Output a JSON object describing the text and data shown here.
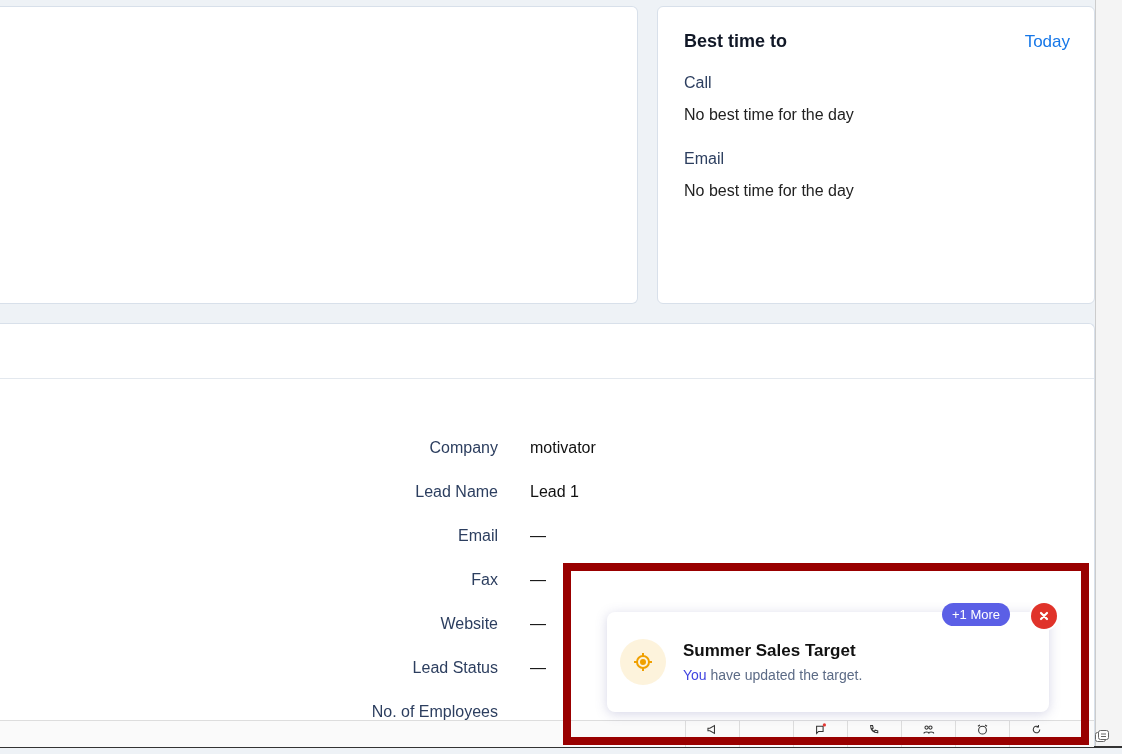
{
  "best_time": {
    "title": "Best time to",
    "link": "Today",
    "sections": [
      {
        "label": "Call",
        "value": "No best time for the day"
      },
      {
        "label": "Email",
        "value": "No best time for the day"
      }
    ]
  },
  "details": {
    "fields": [
      {
        "label": "Company",
        "value": "motivator"
      },
      {
        "label": "Lead Name",
        "value": "Lead 1"
      },
      {
        "label": "Email",
        "value": "—"
      },
      {
        "label": "Fax",
        "value": "—"
      },
      {
        "label": "Website",
        "value": "—"
      },
      {
        "label": "Lead Status",
        "value": "—"
      },
      {
        "label": "No. of Employees"
      }
    ]
  },
  "notification": {
    "title": "Summer Sales Target",
    "message": "**You** have updated the target.",
    "more_badge": "+1 More"
  },
  "toolbar": {
    "items": [
      {
        "kind": "megaphone"
      },
      {
        "kind": "blank"
      },
      {
        "kind": "chat",
        "unread": true
      },
      {
        "kind": "phone",
        "unread": false
      },
      {
        "kind": "people",
        "unread": false
      },
      {
        "kind": "alarm",
        "unread": false
      },
      {
        "kind": "refresh",
        "unread": false
      }
    ]
  }
}
